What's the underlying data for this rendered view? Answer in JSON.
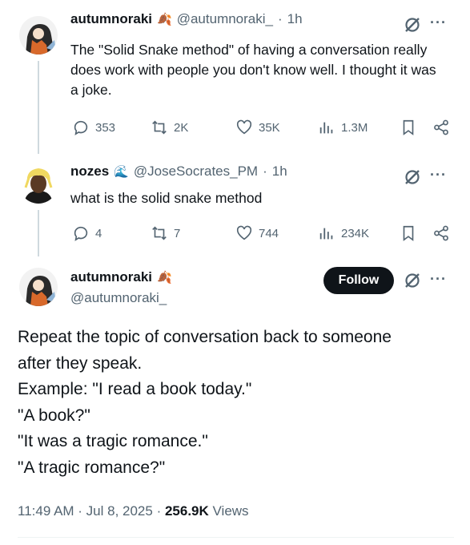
{
  "tweets": [
    {
      "name": "autumnoraki",
      "handle": "@autumnoraki_",
      "time": "1h",
      "text": "The \"Solid Snake method\" of having a conversation really does work with people you don't know well. I thought it was a joke.",
      "replies": "353",
      "reposts": "2K",
      "likes": "35K",
      "views": "1.3M"
    },
    {
      "name": "nozes",
      "handle": "@JoseSocrates_PM",
      "time": "1h",
      "text": "what is the solid snake method",
      "replies": "4",
      "reposts": "7",
      "likes": "744",
      "views": "234K"
    }
  ],
  "main": {
    "name": "autumnoraki",
    "handle": "@autumnoraki_",
    "follow_label": "Follow",
    "lines": [
      "Repeat the topic of conversation back to someone",
      "after they speak.",
      "Example: \"I read a book today.\"",
      "\"A book?\"",
      "\"It was a tragic romance.\"",
      "\"A tragic romance?\""
    ],
    "timestamp": "11:49 AM · Jul 8, 2025 · ",
    "views_count": "256.9K",
    "views_label": " Views"
  },
  "separator": "·",
  "more_label": "···",
  "colors": {
    "text": "#0f1419",
    "secondary": "#536471",
    "follow_bg": "#0f1419"
  }
}
